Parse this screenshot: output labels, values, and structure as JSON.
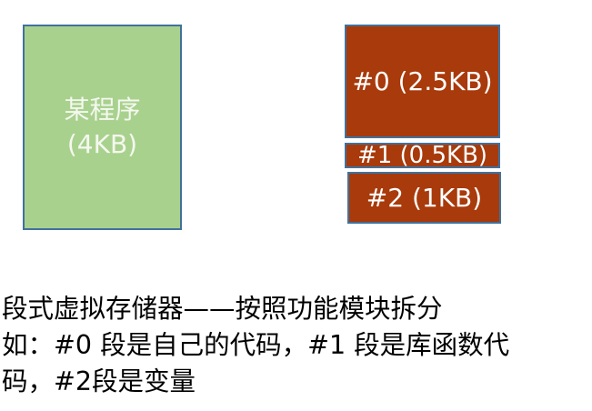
{
  "program": {
    "name": "某程序",
    "size": "(4KB)"
  },
  "segments": [
    {
      "label": "#0 (2.5KB)"
    },
    {
      "label": "#1 (0.5KB)"
    },
    {
      "label": "#2 (1KB)"
    }
  ],
  "caption": {
    "line1": "段式虚拟存储器——按照功能模块拆分",
    "line2": "如：#0 段是自己的代码，#1 段是库函数代",
    "line3": "码，#2段是变量"
  },
  "colors": {
    "program_fill": "#a9d18e",
    "segment_fill": "#a83a0b",
    "border": "#41719c"
  }
}
